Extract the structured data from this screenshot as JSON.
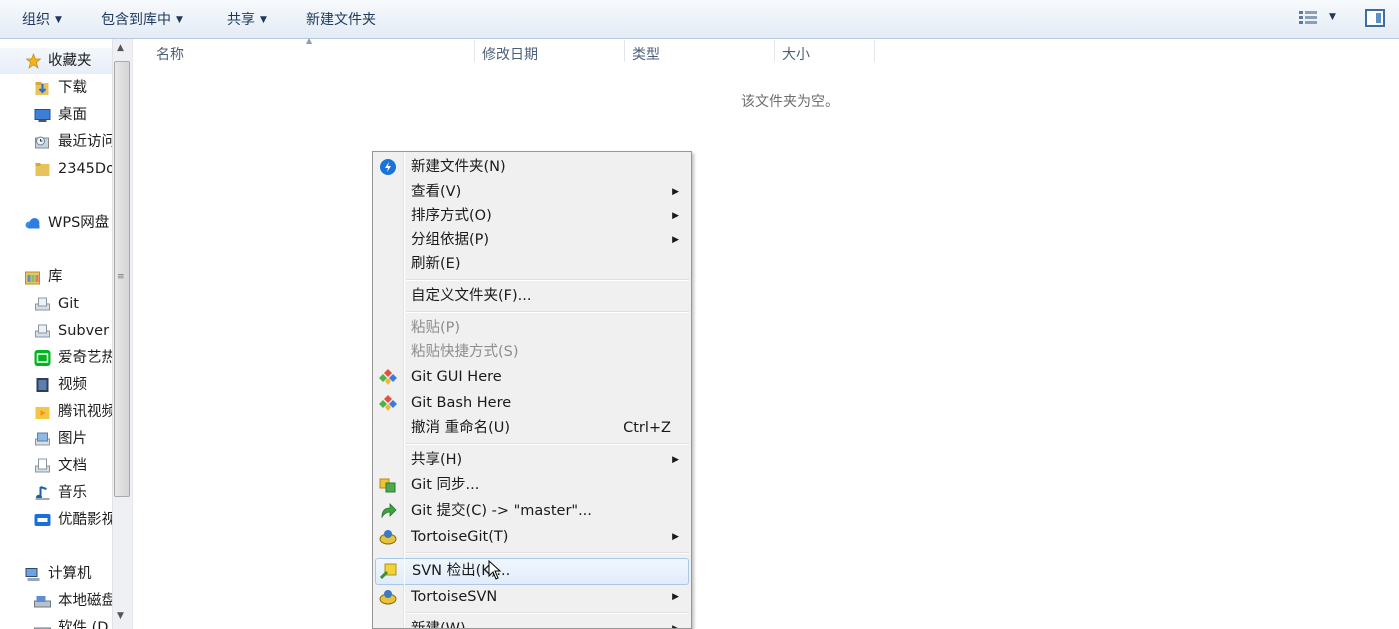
{
  "toolbar": {
    "organize": "组织",
    "include_in_library": "包含到库中",
    "share": "共享",
    "new_folder": "新建文件夹"
  },
  "nav": {
    "favorites": "收藏夹",
    "downloads": "下载",
    "desktop": "桌面",
    "recent": "最近访问",
    "folder_2345": "2345Do",
    "wps": "WPS网盘",
    "libraries": "库",
    "git": "Git",
    "subversion": "Subver",
    "iqiyi": "爱奇艺热",
    "videos": "视频",
    "tencent_video": "腾讯视频",
    "pictures": "图片",
    "documents": "文档",
    "music": "音乐",
    "youku": "优酷影视",
    "computer": "计算机",
    "local_disk": "本地磁盘",
    "software_disk": "软件 (D"
  },
  "columns": {
    "name": "名称",
    "modified": "修改日期",
    "type": "类型",
    "size": "大小"
  },
  "empty_message": "该文件夹为空。",
  "context_menu": {
    "new_folder": "新建文件夹(N)",
    "view": "查看(V)",
    "sort_by": "排序方式(O)",
    "group_by": "分组依据(P)",
    "refresh": "刷新(E)",
    "customize_folder": "自定义文件夹(F)...",
    "paste": "粘贴(P)",
    "paste_shortcut": "粘贴快捷方式(S)",
    "git_gui": "Git GUI Here",
    "git_bash": "Git Bash Here",
    "undo_rename": "撤消 重命名(U)",
    "undo_shortcut": "Ctrl+Z",
    "share": "共享(H)",
    "git_sync": "Git 同步...",
    "git_commit": "Git 提交(C) -> \"master\"...",
    "tortoisegit": "TortoiseGit(T)",
    "svn_checkout": "SVN 检出(K)...",
    "tortoisesvn": "TortoiseSVN",
    "new": "新建(W)"
  },
  "colors": {
    "toolbar_text": "#1e395b",
    "menu_background": "#f0f0f0",
    "highlight_border": "#a8c8ea"
  }
}
